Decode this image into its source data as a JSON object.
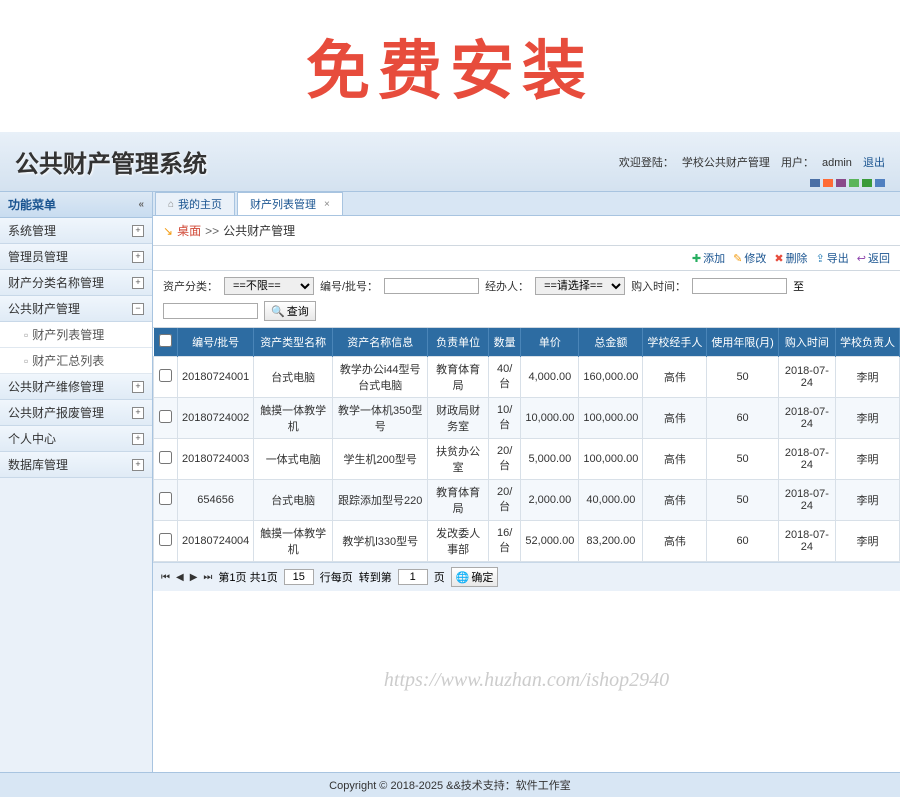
{
  "banner": "免费安装",
  "header": {
    "system_title": "公共财产管理系统",
    "welcome_label": "欢迎登陆：",
    "welcome_name": "学校公共财产管理",
    "user_label": "用户：",
    "user_name": "admin",
    "logout": "退出"
  },
  "color_blocks": [
    "#4a6fa5",
    "#ff6b35",
    "#8a4a8a",
    "#5ab55a",
    "#3a9b3a",
    "#5080c0"
  ],
  "sidebar": {
    "header": "功能菜单",
    "items": [
      {
        "label": "系统管理",
        "expanded": false
      },
      {
        "label": "管理员管理",
        "expanded": false
      },
      {
        "label": "财产分类名称管理",
        "expanded": false
      },
      {
        "label": "公共财产管理",
        "expanded": true,
        "children": [
          {
            "label": "财产列表管理"
          },
          {
            "label": "财产汇总列表"
          }
        ]
      },
      {
        "label": "公共财产维修管理",
        "expanded": false
      },
      {
        "label": "公共财产报废管理",
        "expanded": false
      },
      {
        "label": "个人中心",
        "expanded": false
      },
      {
        "label": "数据库管理",
        "expanded": false
      }
    ]
  },
  "tabs": [
    {
      "label": "我的主页",
      "closable": false,
      "home": true
    },
    {
      "label": "财产列表管理",
      "closable": true,
      "active": true
    }
  ],
  "breadcrumb": {
    "home": "桌面",
    "separator": " >> ",
    "current": "公共财产管理"
  },
  "toolbar": {
    "add": "添加",
    "edit": "修改",
    "delete": "删除",
    "export": "导出",
    "back": "返回"
  },
  "filter": {
    "category_label": "资产分类：",
    "category_value": "==不限==",
    "code_label": "编号/批号：",
    "handler_label": "经办人：",
    "handler_value": "==请选择==",
    "purchase_time_label": "购入时间：",
    "to_label": "至",
    "query": "查询"
  },
  "table": {
    "columns": [
      "编号/批号",
      "资产类型名称",
      "资产名称信息",
      "负责单位",
      "数量",
      "单价",
      "总金额",
      "学校经手人",
      "使用年限(月)",
      "购入时间",
      "学校负责人"
    ],
    "rows": [
      {
        "code": "20180724001",
        "type": "台式电脑",
        "name": "教学办公i44型号台式电脑",
        "unit": "教育体育局",
        "qty": "40/台",
        "price": "4,000.00",
        "total": "160,000.00",
        "handler": "高伟",
        "life": "50",
        "date": "2018-07-24",
        "owner": "李明"
      },
      {
        "code": "20180724002",
        "type": "触摸一体教学机",
        "name": "教学一体机350型号",
        "unit": "财政局财务室",
        "qty": "10/台",
        "price": "10,000.00",
        "total": "100,000.00",
        "handler": "高伟",
        "life": "60",
        "date": "2018-07-24",
        "owner": "李明"
      },
      {
        "code": "20180724003",
        "type": "一体式电脑",
        "name": "学生机200型号",
        "unit": "扶贫办公室",
        "qty": "20/台",
        "price": "5,000.00",
        "total": "100,000.00",
        "handler": "高伟",
        "life": "50",
        "date": "2018-07-24",
        "owner": "李明"
      },
      {
        "code": "654656",
        "type": "台式电脑",
        "name": "跟踪添加型号220",
        "unit": "教育体育局",
        "qty": "20/台",
        "price": "2,000.00",
        "total": "40,000.00",
        "handler": "高伟",
        "life": "50",
        "date": "2018-07-24",
        "owner": "李明"
      },
      {
        "code": "20180724004",
        "type": "触摸一体教学机",
        "name": "教学机l330型号",
        "unit": "发改委人事部",
        "qty": "16/台",
        "price": "52,000.00",
        "total": "83,200.00",
        "handler": "高伟",
        "life": "60",
        "date": "2018-07-24",
        "owner": "李明"
      }
    ]
  },
  "pagination": {
    "page_info": "第1页 共1页",
    "rows_per_page": "15",
    "rows_label": "行每页",
    "goto_label": "转到第",
    "goto_value": "1",
    "page_unit": "页",
    "confirm": "确定"
  },
  "watermark": "https://www.huzhan.com/ishop2940",
  "footer": "Copyright © 2018-2025 &&技术支持：软件工作室"
}
